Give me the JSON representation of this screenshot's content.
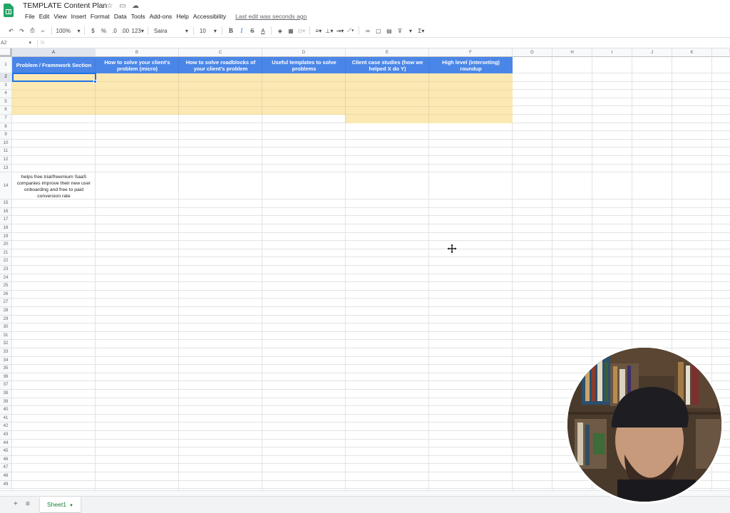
{
  "app": {
    "title": "TEMPLATE Content Plan",
    "icons": [
      "star-icon",
      "move-to-folder-icon",
      "cloud-status-icon"
    ]
  },
  "menu": {
    "items": [
      "File",
      "Edit",
      "View",
      "Insert",
      "Format",
      "Data",
      "Tools",
      "Add-ons",
      "Help",
      "Accessibility"
    ],
    "last_edit": "Last edit was seconds ago"
  },
  "toolbar": {
    "zoom": "100%",
    "currency": "$",
    "percent": "%",
    "decrease_decimal": ".0",
    "increase_decimal": ".00",
    "more_formats": "123",
    "font": "Saira",
    "font_size": "10",
    "bold": "B",
    "italic": "I",
    "strikethrough": "S",
    "text_color": "A",
    "functions": "Σ"
  },
  "formula_bar": {
    "cell_ref": "A2",
    "fx": "fx",
    "content": ""
  },
  "columns": [
    "A",
    "B",
    "C",
    "D",
    "E",
    "F",
    "G",
    "H",
    "I",
    "J",
    "K"
  ],
  "rows": [
    "1",
    "2",
    "3",
    "4",
    "5",
    "6",
    "7",
    "8",
    "9",
    "10",
    "11",
    "12",
    "13",
    "14",
    "15",
    "16",
    "17",
    "18",
    "19",
    "20",
    "21",
    "22",
    "23",
    "24",
    "25",
    "26",
    "27",
    "28",
    "29",
    "30",
    "31",
    "32",
    "33",
    "34",
    "35",
    "36",
    "37",
    "38",
    "39",
    "40",
    "41",
    "42",
    "43",
    "44",
    "45",
    "46",
    "47",
    "48",
    "49"
  ],
  "cells": {
    "A1": "Problem / Framework Section",
    "B1": "How to solve your client's problem (micro)",
    "C1": "How to solve roadblocks of your client's problem",
    "D1": "Useful templates to solve problems",
    "E1": "Client case studies (how we helped X do Y)",
    "F1": "High level (interseting) roundup",
    "A14": "helps free trial/freemium SaaS companies improve their new user onboarding and free to paid conversion rate"
  },
  "colors": {
    "header_fill": "#4a86e8",
    "highlight_fill": "#fce8b2",
    "selection": "#1a73e8",
    "sheet_tab_text": "#188038"
  },
  "sheets": {
    "active": "Sheet1"
  },
  "bottom_icons": [
    "add-sheet-icon",
    "all-sheets-icon"
  ]
}
